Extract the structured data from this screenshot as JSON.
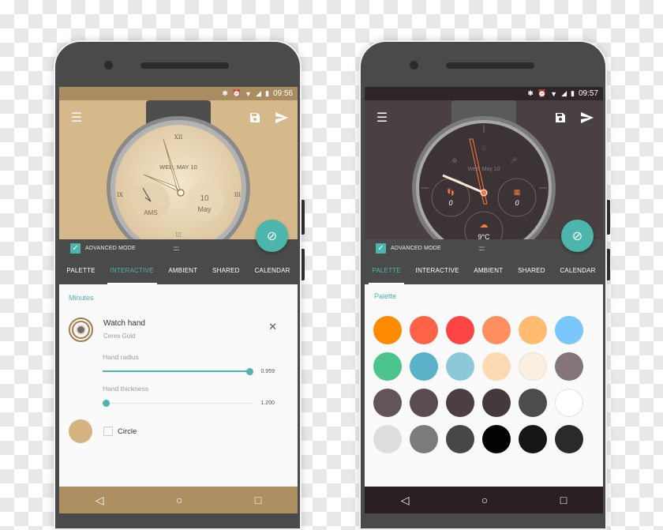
{
  "phone1": {
    "status": {
      "time": "09:56",
      "icons": [
        "bluetooth-icon",
        "alarm-icon",
        "wifi-icon",
        "signal-icon",
        "battery-icon"
      ]
    },
    "toolbar": {
      "menu_icon": "≡",
      "save_icon": "save-icon",
      "send_icon": "send-icon"
    },
    "watch": {
      "date_text": "WED, MAY 10",
      "subdial_left": "AMS",
      "subdial_right_day": "10",
      "subdial_right_month": "May",
      "numerals": [
        "XII",
        "III",
        "VI",
        "IX"
      ]
    },
    "advanced_mode_label": "ADVANCED MODE",
    "advanced_mode_checked": true,
    "tabs": [
      {
        "label": "PALETTE",
        "active": false
      },
      {
        "label": "INTERACTIVE",
        "active": true
      },
      {
        "label": "AMBIENT",
        "active": false
      },
      {
        "label": "SHARED",
        "active": false
      },
      {
        "label": "CALENDAR",
        "active": false
      }
    ],
    "section_title": "Minutes",
    "hand": {
      "title": "Watch hand",
      "subtitle": "Ceres Gold"
    },
    "sliders": [
      {
        "label": "Hand radius",
        "value": "0.959",
        "fraction": 0.98
      },
      {
        "label": "Hand thickness",
        "value": "1.200",
        "fraction": 0.02
      }
    ],
    "circle": {
      "label": "Circle",
      "checked": false,
      "swatch_color": "#d4b483"
    },
    "accent": "#4db6ac"
  },
  "phone2": {
    "status": {
      "time": "09:57",
      "icons": [
        "bluetooth-icon",
        "alarm-icon",
        "wifi-icon",
        "signal-icon",
        "battery-icon"
      ]
    },
    "watch": {
      "date_text": "Wed, May 10",
      "steps": "0",
      "events": "0",
      "temperature": "9°C"
    },
    "advanced_mode_label": "ADVANCED MODE",
    "advanced_mode_checked": true,
    "tabs": [
      {
        "label": "PALETTE",
        "active": true
      },
      {
        "label": "INTERACTIVE",
        "active": false
      },
      {
        "label": "AMBIENT",
        "active": false
      },
      {
        "label": "SHARED",
        "active": false
      },
      {
        "label": "CALENDAR",
        "active": false
      }
    ],
    "section_title": "Palette",
    "palette": [
      "#ff8c00",
      "#ff6347",
      "#ff4444",
      "#ff8f5e",
      "#ffbb70",
      "#79c7fb",
      "#4cc48d",
      "#5ab1c8",
      "#8cc9d8",
      "#fedab2",
      "#fbefe1",
      "#857579",
      "#625558",
      "#5a4c4f",
      "#4b3f41",
      "#443a3d",
      "#4c4c4c",
      "#ffffff",
      "#dddddd",
      "#7b7b7b",
      "#474747",
      "#030303",
      "#151515",
      "#2a2a2a"
    ]
  },
  "nav": {
    "back": "◁",
    "home": "○",
    "recents": "□"
  }
}
